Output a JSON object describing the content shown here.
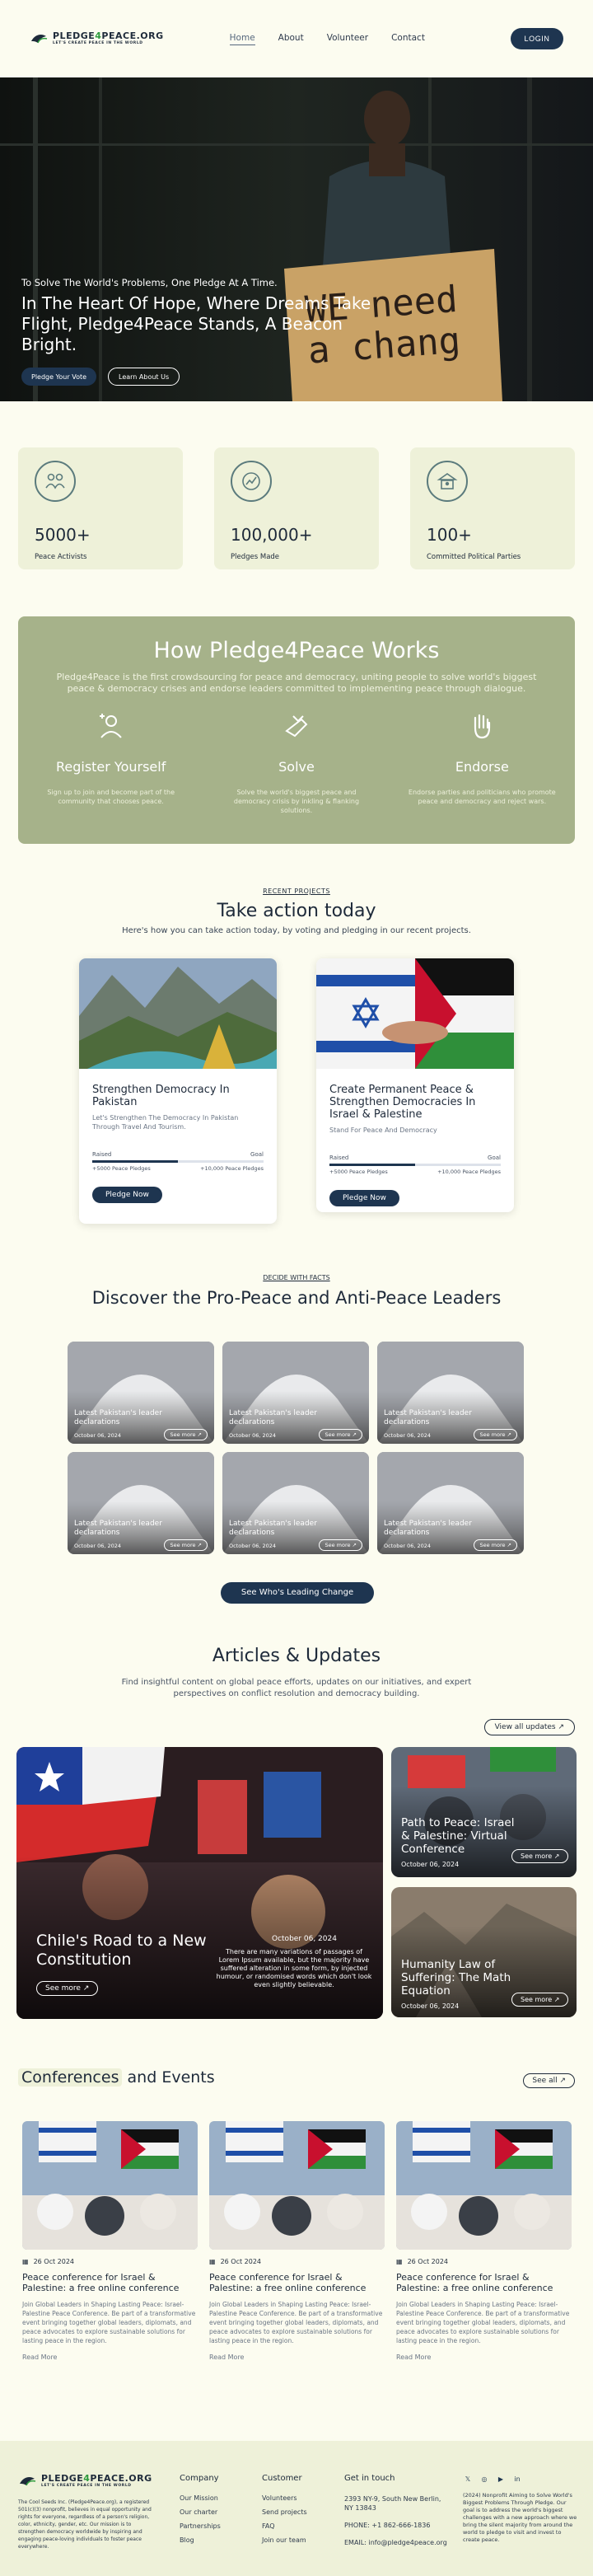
{
  "nav": {
    "logo_title_a": "PLEDGE",
    "logo_title_amp": "4",
    "logo_title_b": "PEACE.ORG",
    "logo_tagline": "LET'S CREATE PEACE IN THE WORLD",
    "links": [
      "Home",
      "About",
      "Volunteer",
      "Contact"
    ],
    "login": "LOGIN"
  },
  "hero": {
    "subtitle": "To Solve The World's Problems, One Pledge At A Time.",
    "title": "In The Heart Of Hope, Where Dreams Take Flight, Pledge4Peace Stands, A Beacon Bright.",
    "sign_text": "WE need a chang",
    "btn_pledge": "Pledge Your Vote",
    "btn_learn": "Learn About Us"
  },
  "stats": [
    {
      "icon": "activists-icon",
      "value": "5000+",
      "label": "Peace Activists"
    },
    {
      "icon": "pledges-icon",
      "value": "100,000+",
      "label": "Pledges Made"
    },
    {
      "icon": "parties-icon",
      "value": "100+",
      "label": "Committed Political Parties"
    }
  ],
  "how": {
    "title": "How Pledge4Peace Works",
    "desc": "Pledge4Peace is the first crowdsourcing for peace and democracy, uniting people to solve world's biggest peace & democracy crises and endorse leaders committed to implementing peace through dialogue.",
    "steps": [
      {
        "title": "Register Yourself",
        "desc": "Sign up to join and become part of the community that chooses peace."
      },
      {
        "title": "Solve",
        "desc": "Solve the world's biggest peace and democracy crisis by inkling & flanking solutions."
      },
      {
        "title": "Endorse",
        "desc": "Endorse parties and politicians who promote peace and democracy and reject wars."
      }
    ]
  },
  "projects": {
    "kicker": "RECENT PROJECTS",
    "title": "Take action today",
    "subtitle": "Here's how you can take action today, by voting and pledging in our recent projects.",
    "cards": [
      {
        "title": "Strengthen Democracy In Pakistan",
        "desc": "Let's Strengthen The Democracy In Pakistan Through Travel And Tourism.",
        "raised_label": "Raised",
        "goal_label": "Goal",
        "raised": "+5000 Peace Pledges",
        "goal": "+10,000 Peace Pledges",
        "progress": 0.5,
        "button": "Pledge Now"
      },
      {
        "title": "Create Permanent Peace & Strengthen Democracies In Israel & Palestine",
        "desc": "Stand For Peace And Democracy",
        "raised_label": "Raised",
        "goal_label": "Goal",
        "raised": "+5000 Peace Pledges",
        "goal": "+10,000 Peace Pledges",
        "progress": 0.5,
        "button": "Pledge Now"
      }
    ]
  },
  "leaders": {
    "kicker": "DECIDE WITH FACTS",
    "title": "Discover the Pro-Peace and Anti-Peace Leaders",
    "cards": [
      {
        "title": "Latest Pakistan's leader declarations",
        "date": "October 06, 2024",
        "more": "See more"
      },
      {
        "title": "Latest Pakistan's leader declarations",
        "date": "October 06, 2024",
        "more": "See more"
      },
      {
        "title": "Latest Pakistan's leader declarations",
        "date": "October 06, 2024",
        "more": "See more"
      },
      {
        "title": "Latest Pakistan's leader declarations",
        "date": "October 06, 2024",
        "more": "See more"
      },
      {
        "title": "Latest Pakistan's leader declarations",
        "date": "October 06, 2024",
        "more": "See more"
      },
      {
        "title": "Latest Pakistan's leader declarations",
        "date": "October 06, 2024",
        "more": "See more"
      }
    ],
    "button": "See Who's Leading Change"
  },
  "articles": {
    "title": "Articles & Updates",
    "subtitle": "Find insightful content on global peace efforts, updates on our initiatives, and expert perspectives on conflict resolution and democracy building.",
    "view_all": "View all updates",
    "main": {
      "title": "Chile's Road to a New Constitution",
      "date": "October 06, 2024",
      "desc": "There are many variations of passages of Lorem Ipsum available, but the majority have suffered alteration in some form, by injected humour, or randomised words which don't look even slightly believable.",
      "more": "See more"
    },
    "side": [
      {
        "title": "Path to Peace: Israel & Palestine: Virtual Conference",
        "date": "October 06, 2024",
        "more": "See more"
      },
      {
        "title": "Humanity Law of Suffering: The Math Equation",
        "date": "October 06, 2024",
        "more": "See more"
      }
    ]
  },
  "conferences": {
    "title_hl": "Conferences",
    "title_rest": "and Events",
    "see_all": "See all",
    "cards": [
      {
        "date": "26 Oct 2024",
        "title": "Peace conference for Israel & Palestine: a free online conference",
        "desc": "Join Global Leaders in Shaping Lasting Peace: Israel-Palestine Peace Conference. Be part of a transformative event bringing together global leaders, diplomats, and peace advocates to explore sustainable solutions for lasting peace in the region.",
        "more": "Read More"
      },
      {
        "date": "26 Oct 2024",
        "title": "Peace conference for Israel & Palestine: a free online conference",
        "desc": "Join Global Leaders in Shaping Lasting Peace: Israel-Palestine Peace Conference. Be part of a transformative event bringing together global leaders, diplomats, and peace advocates to explore sustainable solutions for lasting peace in the region.",
        "more": "Read More"
      },
      {
        "date": "26 Oct 2024",
        "title": "Peace conference for Israel & Palestine: a free online conference",
        "desc": "Join Global Leaders in Shaping Lasting Peace: Israel-Palestine Peace Conference. Be part of a transformative event bringing together global leaders, diplomats, and peace advocates to explore sustainable solutions for lasting peace in the region.",
        "more": "Read More"
      }
    ]
  },
  "footer": {
    "about": "The Cool Seeds Inc. (Pledge4Peace.org), a registered 501(c)(3) nonprofit, believes in equal opportunity and rights for everyone, regardless of a person's religion, color, ethnicity, gender, etc. Our mission is to strengthen democracy worldwide by inspiring and engaging peace-loving individuals to foster peace everywhere.",
    "company": {
      "title": "Company",
      "links": [
        "Our Mission",
        "Our charter",
        "Partnerships",
        "Blog"
      ]
    },
    "customer": {
      "title": "Customer",
      "links": [
        "Volunteers",
        "Send projects",
        "FAQ",
        "Join our team"
      ]
    },
    "contact": {
      "title": "Get in touch",
      "address": "2393 NY-9, South New Berlin, NY 13843",
      "phone": "PHONE: +1 862-666-1836",
      "email": "EMAIL: info@pledge4peace.org"
    },
    "right_text": "(2024) Nonprofit Aiming to Solve World's Biggest Problems Through Pledge. Our goal is to address the world's biggest challenges with a new approach where we bring the silent majority from around the world to pledge to visit and invest to create peace."
  }
}
